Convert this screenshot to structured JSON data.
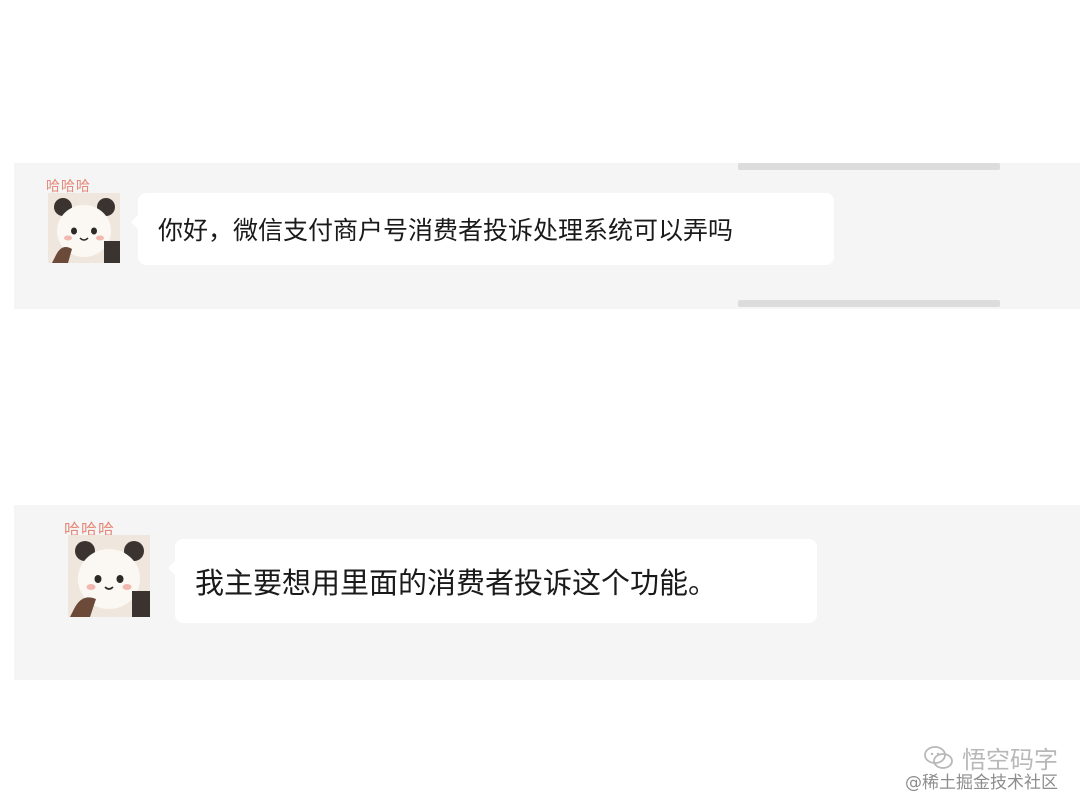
{
  "messages": [
    {
      "emote": "哈哈哈",
      "avatar_icon": "panda-sticker-avatar",
      "text": "你好，微信支付商户号消费者投诉处理系统可以弄吗"
    },
    {
      "emote": "哈哈哈",
      "avatar_icon": "panda-sticker-avatar",
      "text": "我主要想用里面的消费者投诉这个功能。"
    }
  ],
  "watermark": {
    "icon": "wechat-icon",
    "account": "悟空码字",
    "community": "@稀土掘金技术社区"
  }
}
